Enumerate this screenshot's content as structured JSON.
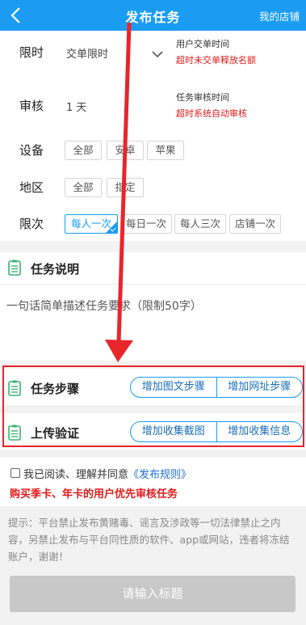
{
  "header": {
    "title": "发布任务",
    "right_link": "我的店铺"
  },
  "settings": {
    "time_limit": {
      "label": "限时",
      "value": "交单限时",
      "note_title": "用户交单时间",
      "note_warning": "超时未交单释放名额"
    },
    "review": {
      "label": "审核",
      "value": "1 天",
      "note_title": "任务审核时间",
      "note_warning": "超时系统自动审核"
    },
    "device": {
      "label": "设备",
      "options": [
        "全部",
        "安卓",
        "苹果"
      ]
    },
    "region": {
      "label": "地区",
      "options": [
        "全部",
        "指定"
      ]
    },
    "frequency": {
      "label": "限次",
      "options": [
        "每人一次",
        "每日一次",
        "每人三次",
        "店铺一次"
      ],
      "selected": "每人一次"
    }
  },
  "task_description": {
    "title": "任务说明",
    "placeholder": "一句话简单描述任务要求（限制50字）"
  },
  "task_steps": {
    "title": "任务步骤",
    "buttons": [
      "增加图文步骤",
      "增加网址步骤"
    ]
  },
  "upload_verify": {
    "title": "上传验证",
    "buttons": [
      "增加收集截图",
      "增加收集信息"
    ]
  },
  "agreement": {
    "prefix": "我已阅读、理解并同意",
    "link": "《发布规则》",
    "notice": "购买季卡、年卡的用户优先审核任务"
  },
  "tips": "提示：平台禁止发布黄赌毒、谣言及涉政等一切法律禁止之内容，另禁止发布与平台同性质的软件、app或网站，违者将冻结账户，谢谢！",
  "submit": {
    "label": "请输入标题"
  },
  "colors": {
    "brand": "#1a9cf3",
    "warning": "#e21a1a",
    "annotation": "#e8252b"
  }
}
